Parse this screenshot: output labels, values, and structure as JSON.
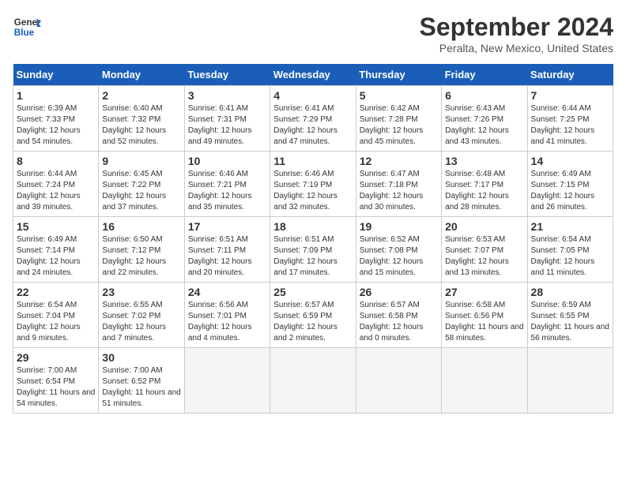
{
  "header": {
    "logo_line1": "General",
    "logo_line2": "Blue",
    "month": "September 2024",
    "location": "Peralta, New Mexico, United States"
  },
  "weekdays": [
    "Sunday",
    "Monday",
    "Tuesday",
    "Wednesday",
    "Thursday",
    "Friday",
    "Saturday"
  ],
  "weeks": [
    [
      {
        "day": 1,
        "sunrise": "6:39 AM",
        "sunset": "7:33 PM",
        "daylight": "12 hours and 54 minutes."
      },
      {
        "day": 2,
        "sunrise": "6:40 AM",
        "sunset": "7:32 PM",
        "daylight": "12 hours and 52 minutes."
      },
      {
        "day": 3,
        "sunrise": "6:41 AM",
        "sunset": "7:31 PM",
        "daylight": "12 hours and 49 minutes."
      },
      {
        "day": 4,
        "sunrise": "6:41 AM",
        "sunset": "7:29 PM",
        "daylight": "12 hours and 47 minutes."
      },
      {
        "day": 5,
        "sunrise": "6:42 AM",
        "sunset": "7:28 PM",
        "daylight": "12 hours and 45 minutes."
      },
      {
        "day": 6,
        "sunrise": "6:43 AM",
        "sunset": "7:26 PM",
        "daylight": "12 hours and 43 minutes."
      },
      {
        "day": 7,
        "sunrise": "6:44 AM",
        "sunset": "7:25 PM",
        "daylight": "12 hours and 41 minutes."
      }
    ],
    [
      {
        "day": 8,
        "sunrise": "6:44 AM",
        "sunset": "7:24 PM",
        "daylight": "12 hours and 39 minutes."
      },
      {
        "day": 9,
        "sunrise": "6:45 AM",
        "sunset": "7:22 PM",
        "daylight": "12 hours and 37 minutes."
      },
      {
        "day": 10,
        "sunrise": "6:46 AM",
        "sunset": "7:21 PM",
        "daylight": "12 hours and 35 minutes."
      },
      {
        "day": 11,
        "sunrise": "6:46 AM",
        "sunset": "7:19 PM",
        "daylight": "12 hours and 32 minutes."
      },
      {
        "day": 12,
        "sunrise": "6:47 AM",
        "sunset": "7:18 PM",
        "daylight": "12 hours and 30 minutes."
      },
      {
        "day": 13,
        "sunrise": "6:48 AM",
        "sunset": "7:17 PM",
        "daylight": "12 hours and 28 minutes."
      },
      {
        "day": 14,
        "sunrise": "6:49 AM",
        "sunset": "7:15 PM",
        "daylight": "12 hours and 26 minutes."
      }
    ],
    [
      {
        "day": 15,
        "sunrise": "6:49 AM",
        "sunset": "7:14 PM",
        "daylight": "12 hours and 24 minutes."
      },
      {
        "day": 16,
        "sunrise": "6:50 AM",
        "sunset": "7:12 PM",
        "daylight": "12 hours and 22 minutes."
      },
      {
        "day": 17,
        "sunrise": "6:51 AM",
        "sunset": "7:11 PM",
        "daylight": "12 hours and 20 minutes."
      },
      {
        "day": 18,
        "sunrise": "6:51 AM",
        "sunset": "7:09 PM",
        "daylight": "12 hours and 17 minutes."
      },
      {
        "day": 19,
        "sunrise": "6:52 AM",
        "sunset": "7:08 PM",
        "daylight": "12 hours and 15 minutes."
      },
      {
        "day": 20,
        "sunrise": "6:53 AM",
        "sunset": "7:07 PM",
        "daylight": "12 hours and 13 minutes."
      },
      {
        "day": 21,
        "sunrise": "6:54 AM",
        "sunset": "7:05 PM",
        "daylight": "12 hours and 11 minutes."
      }
    ],
    [
      {
        "day": 22,
        "sunrise": "6:54 AM",
        "sunset": "7:04 PM",
        "daylight": "12 hours and 9 minutes."
      },
      {
        "day": 23,
        "sunrise": "6:55 AM",
        "sunset": "7:02 PM",
        "daylight": "12 hours and 7 minutes."
      },
      {
        "day": 24,
        "sunrise": "6:56 AM",
        "sunset": "7:01 PM",
        "daylight": "12 hours and 4 minutes."
      },
      {
        "day": 25,
        "sunrise": "6:57 AM",
        "sunset": "6:59 PM",
        "daylight": "12 hours and 2 minutes."
      },
      {
        "day": 26,
        "sunrise": "6:57 AM",
        "sunset": "6:58 PM",
        "daylight": "12 hours and 0 minutes."
      },
      {
        "day": 27,
        "sunrise": "6:58 AM",
        "sunset": "6:56 PM",
        "daylight": "11 hours and 58 minutes."
      },
      {
        "day": 28,
        "sunrise": "6:59 AM",
        "sunset": "6:55 PM",
        "daylight": "11 hours and 56 minutes."
      }
    ],
    [
      {
        "day": 29,
        "sunrise": "7:00 AM",
        "sunset": "6:54 PM",
        "daylight": "11 hours and 54 minutes."
      },
      {
        "day": 30,
        "sunrise": "7:00 AM",
        "sunset": "6:52 PM",
        "daylight": "11 hours and 51 minutes."
      },
      null,
      null,
      null,
      null,
      null
    ]
  ]
}
